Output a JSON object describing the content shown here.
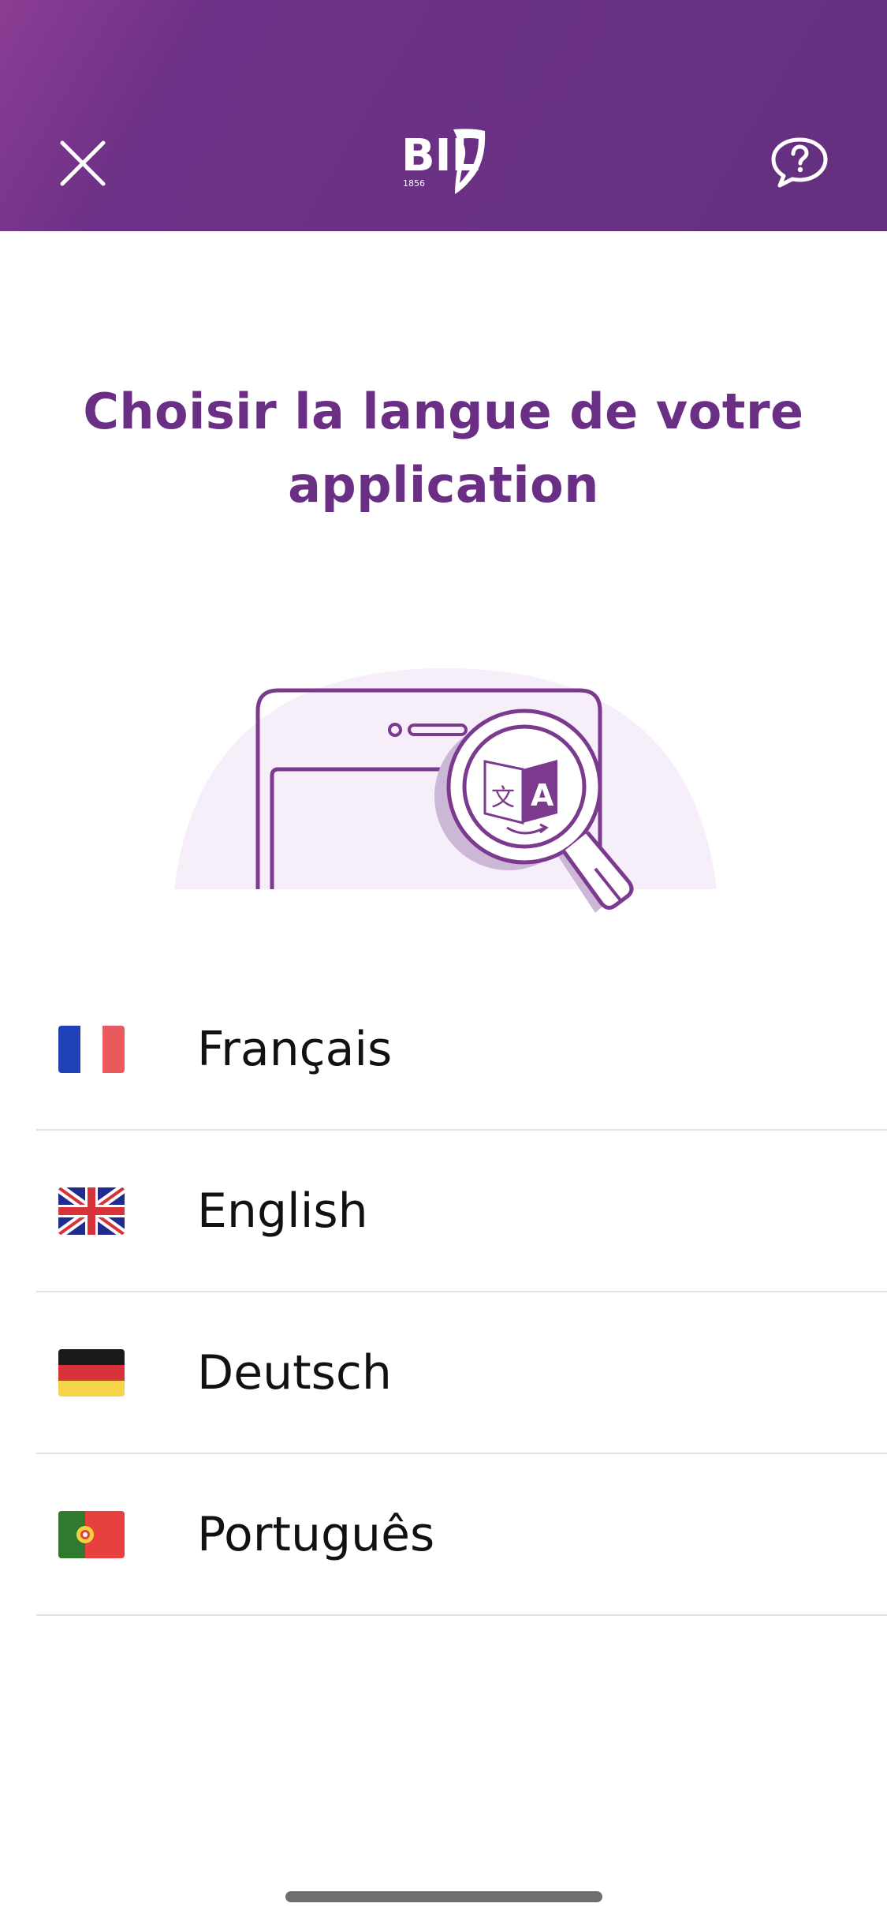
{
  "header": {
    "logo": {
      "text": "BIL",
      "year": "1856"
    },
    "close_icon": "close-icon",
    "help_icon": "chat-help-icon",
    "gradient_start": "#8a3d93",
    "gradient_end": "#65307f"
  },
  "main": {
    "title": "Choisir la langue de votre application",
    "illustration_icon": "phone-translate-magnifier-icon",
    "accent_color": "#6a2f85"
  },
  "languages": [
    {
      "label": "Français",
      "flag_icon": "flag-france-icon"
    },
    {
      "label": "English",
      "flag_icon": "flag-uk-icon"
    },
    {
      "label": "Deutsch",
      "flag_icon": "flag-germany-icon"
    },
    {
      "label": "Português",
      "flag_icon": "flag-portugal-icon"
    }
  ]
}
